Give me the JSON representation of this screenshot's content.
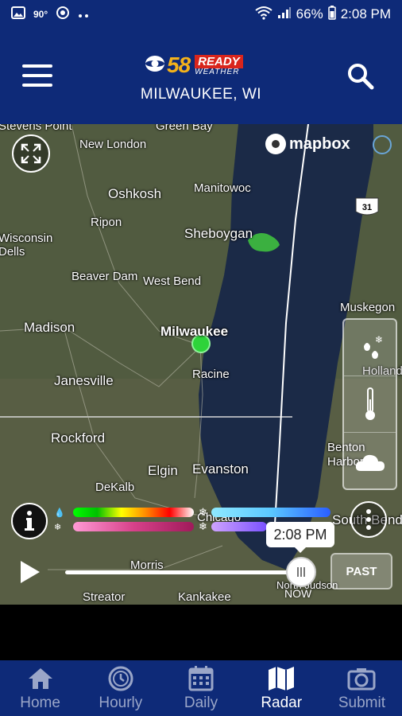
{
  "status_bar": {
    "left_icons": [
      "image-icon",
      "temperature-icon",
      "sync-icon",
      "more-dots-icon"
    ],
    "temperature": "90°",
    "battery": "66%",
    "time": "2:08 PM"
  },
  "header": {
    "logo": {
      "network": "CBS",
      "channel": "58",
      "brand_top": "READY",
      "brand_bottom": "WEATHER"
    },
    "location": "MILWAUKEE, WI",
    "menu_icon": "hamburger-icon",
    "search_icon": "search-icon"
  },
  "map": {
    "attribution": "mapbox",
    "cities": [
      {
        "name": "Stevens Point"
      },
      {
        "name": "Green Bay"
      },
      {
        "name": "New London"
      },
      {
        "name": "Oshkosh"
      },
      {
        "name": "Manitowoc"
      },
      {
        "name": "Ripon"
      },
      {
        "name": "Sheboygan"
      },
      {
        "name": "Wisconsin Dells"
      },
      {
        "name": "Beaver Dam"
      },
      {
        "name": "West Bend"
      },
      {
        "name": "Madison"
      },
      {
        "name": "Milwaukee"
      },
      {
        "name": "Racine"
      },
      {
        "name": "Janesville"
      },
      {
        "name": "Rockford"
      },
      {
        "name": "Elgin"
      },
      {
        "name": "Evanston"
      },
      {
        "name": "DeKalb"
      },
      {
        "name": "Chicago"
      },
      {
        "name": "Morris"
      },
      {
        "name": "Streator"
      },
      {
        "name": "Kankakee"
      },
      {
        "name": "Muskegon"
      },
      {
        "name": "Holland"
      },
      {
        "name": "Benton Harbor"
      },
      {
        "name": "South Bend"
      },
      {
        "name": "North Judson"
      }
    ],
    "highway_shield": "31",
    "layers": [
      {
        "name": "precipitation",
        "icon": "precip-icon"
      },
      {
        "name": "temperature",
        "icon": "thermometer-icon"
      },
      {
        "name": "clouds",
        "icon": "cloud-icon"
      }
    ],
    "legend_colors": {
      "rain": [
        "#00ff00",
        "#00c000",
        "#ffff00",
        "#ff8c00",
        "#ff0000",
        "#ffffff"
      ],
      "snow": [
        "#8fe9ff",
        "#5bc8ff",
        "#2a5eff"
      ],
      "mix": [
        "#ff9ad5",
        "#d7418a",
        "#a01a5a"
      ],
      "ice": [
        "#cfa3ff",
        "#7a52ff"
      ]
    },
    "timeline": {
      "time": "2:08 PM",
      "now_label": "NOW",
      "past_button": "PAST",
      "progress": 0.94
    }
  },
  "bottom_nav": [
    {
      "label": "Home",
      "icon": "home-icon",
      "active": false
    },
    {
      "label": "Hourly",
      "icon": "clock-icon",
      "active": false
    },
    {
      "label": "Daily",
      "icon": "calendar-icon",
      "active": false
    },
    {
      "label": "Radar",
      "icon": "map-icon",
      "active": true
    },
    {
      "label": "Submit",
      "icon": "camera-icon",
      "active": false
    }
  ],
  "colors": {
    "brand_blue": "#0e2a78",
    "inactive_nav": "#9aa6c8",
    "location_dot": "#2ed33a",
    "lake": "#1b2a47"
  }
}
